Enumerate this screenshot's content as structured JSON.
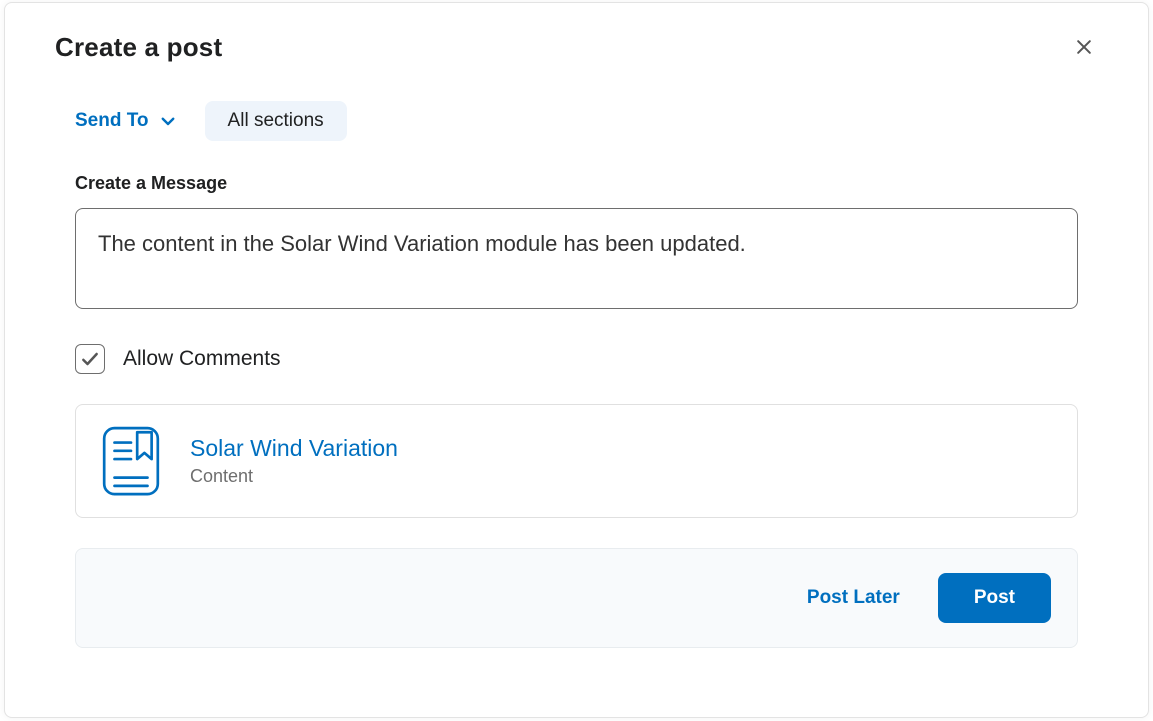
{
  "modal": {
    "title": "Create a post"
  },
  "send": {
    "label": "Send To",
    "chip": "All sections"
  },
  "message": {
    "label": "Create a Message",
    "value": "The content in the Solar Wind Variation module has been updated."
  },
  "allow_comments": {
    "label": "Allow Comments",
    "checked": true
  },
  "attachment": {
    "title": "Solar Wind Variation",
    "subtitle": "Content"
  },
  "actions": {
    "post_later": "Post Later",
    "post": "Post"
  }
}
